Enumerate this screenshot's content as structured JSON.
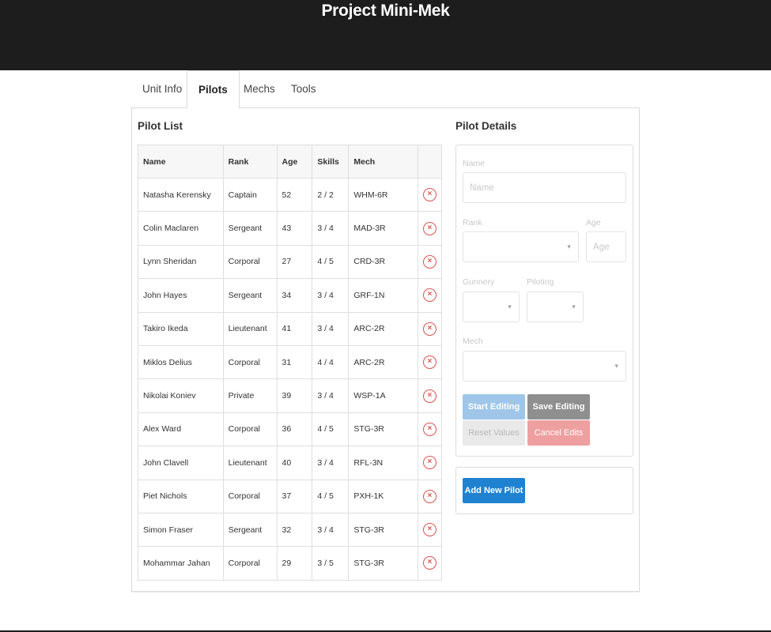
{
  "app": {
    "title": "Project Mini-Mek"
  },
  "tabs": [
    {
      "label": "Unit Info"
    },
    {
      "label": "Pilots"
    },
    {
      "label": "Mechs"
    },
    {
      "label": "Tools"
    }
  ],
  "pilot_list": {
    "title": "Pilot List",
    "columns": [
      "Name",
      "Rank",
      "Age",
      "Skills",
      "Mech"
    ],
    "rows": [
      {
        "name": "Natasha Kerensky",
        "rank": "Captain",
        "age": "52",
        "skills": "2 / 2",
        "mech": "WHM-6R"
      },
      {
        "name": "Colin Maclaren",
        "rank": "Sergeant",
        "age": "43",
        "skills": "3 / 4",
        "mech": "MAD-3R"
      },
      {
        "name": "Lynn Sheridan",
        "rank": "Corporal",
        "age": "27",
        "skills": "4 / 5",
        "mech": "CRD-3R"
      },
      {
        "name": "John Hayes",
        "rank": "Sergeant",
        "age": "34",
        "skills": "3 / 4",
        "mech": "GRF-1N"
      },
      {
        "name": "Takiro Ikeda",
        "rank": "Lieutenant",
        "age": "41",
        "skills": "3 / 4",
        "mech": "ARC-2R"
      },
      {
        "name": "Miklos Delius",
        "rank": "Corporal",
        "age": "31",
        "skills": "4 / 4",
        "mech": "ARC-2R"
      },
      {
        "name": "Nikolai Koniev",
        "rank": "Private",
        "age": "39",
        "skills": "3 / 4",
        "mech": "WSP-1A"
      },
      {
        "name": "Alex Ward",
        "rank": "Corporal",
        "age": "36",
        "skills": "4 / 5",
        "mech": "STG-3R"
      },
      {
        "name": "John Clavell",
        "rank": "Lieutenant",
        "age": "40",
        "skills": "3 / 4",
        "mech": "RFL-3N"
      },
      {
        "name": "Piet Nichols",
        "rank": "Corporal",
        "age": "37",
        "skills": "4 / 5",
        "mech": "PXH-1K"
      },
      {
        "name": "Simon Fraser",
        "rank": "Sergeant",
        "age": "32",
        "skills": "3 / 4",
        "mech": "STG-3R"
      },
      {
        "name": "Mohammar Jahan",
        "rank": "Corporal",
        "age": "29",
        "skills": "3 / 5",
        "mech": "STG-3R"
      }
    ],
    "delete_icon": "×"
  },
  "details": {
    "title": "Pilot Details",
    "name_label": "Name",
    "name_placeholder": "Name",
    "rank_label": "Rank",
    "age_label": "Age",
    "age_placeholder": "Age",
    "gunnery_label": "Gunnery",
    "piloting_label": "Piloting",
    "mech_label": "Mech",
    "caret_icon": "▼",
    "start_editing": "Start Editing",
    "save_editing": "Save Editing",
    "reset_values": "Reset Values",
    "cancel_edits": "Cancel Edits",
    "add_new_pilot": "Add New Pilot"
  },
  "colors": {
    "header_bg": "#1d1d1d",
    "start_editing": "#9fc6e8",
    "save_editing": "#8f8f8f",
    "reset_values": "#e9e9e9",
    "cancel_edits": "#ee9f9f",
    "add_new_pilot": "#1f82d1",
    "delete": "#d9534f"
  }
}
